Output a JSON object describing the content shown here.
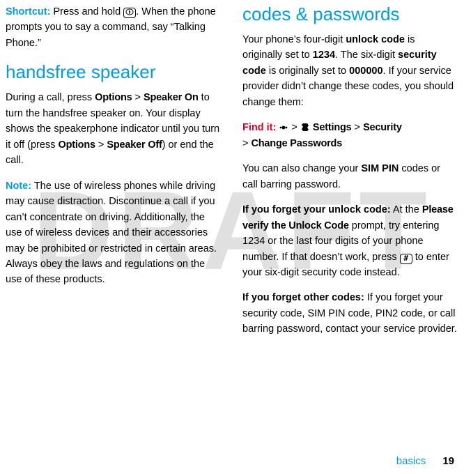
{
  "left": {
    "shortcut_label": "Shortcut:",
    "shortcut_text_1": " Press and hold ",
    "shortcut_text_2": ". When the phone prompts you to say a command, say “Talking Phone.”",
    "voice_key_glyph": "Ⓥ",
    "handsfree_heading": "handsfree speaker",
    "handsfree_p1_a": "During a call, press ",
    "handsfree_p1_options": "Options",
    "handsfree_p1_gt1": " > ",
    "handsfree_p1_speaker_on": "Speaker On",
    "handsfree_p1_b": " to turn the handsfree speaker on. Your display shows the speakerphone indicator until you turn it off (press ",
    "handsfree_p1_options2": "Options",
    "handsfree_p1_gt2": " > ",
    "handsfree_p1_speaker_off": "Speaker Off",
    "handsfree_p1_c": ") or end the call.",
    "note_label": "Note:",
    "note_text": " The use of wireless phones while driving may cause distraction. Discontinue a call if you can’t concentrate on driving. Additionally, the use of wireless devices and their accessories may be prohibited or restricted in certain areas. Always obey the laws and regulations on the use of these products."
  },
  "right": {
    "codes_heading": "codes & passwords",
    "codes_p1_a": "Your phone’s four-digit ",
    "codes_p1_unlock": "unlock code",
    "codes_p1_b": " is originally set to ",
    "codes_p1_1234": "1234",
    "codes_p1_c": ". The six-digit ",
    "codes_p1_security": "security code",
    "codes_p1_d": " is originally set to ",
    "codes_p1_000000": "000000",
    "codes_p1_e": ". If your service provider didn’t change these codes, you should change them:",
    "findit_label": "Find it:",
    "findit_gt1": " > ",
    "findit_settings": "Settings",
    "findit_gt2": " > ",
    "findit_security": "Security",
    "findit_gt3": "> ",
    "findit_change": "Change Passwords",
    "codes_p2_a": "You can also change your ",
    "codes_p2_simpin": "SIM PIN",
    "codes_p2_b": " codes or call barring password.",
    "forget_unlock_label": "If you forget your unlock code:",
    "forget_unlock_a": " At the ",
    "forget_unlock_prompt": "Please verify the Unlock Code",
    "forget_unlock_b": " prompt, try entering 1234 or the last four digits of your phone number. If that doesn’t work, press ",
    "hash_key": "#",
    "forget_unlock_c": " to enter your six-digit security code instead.",
    "forget_other_label": "If you forget other codes:",
    "forget_other_text": " If you forget your security code, SIM PIN code, PIN2 code, or call barring password, contact your service provider."
  },
  "watermark": "DRAFT",
  "footer": {
    "label": "basics",
    "page": "19"
  }
}
